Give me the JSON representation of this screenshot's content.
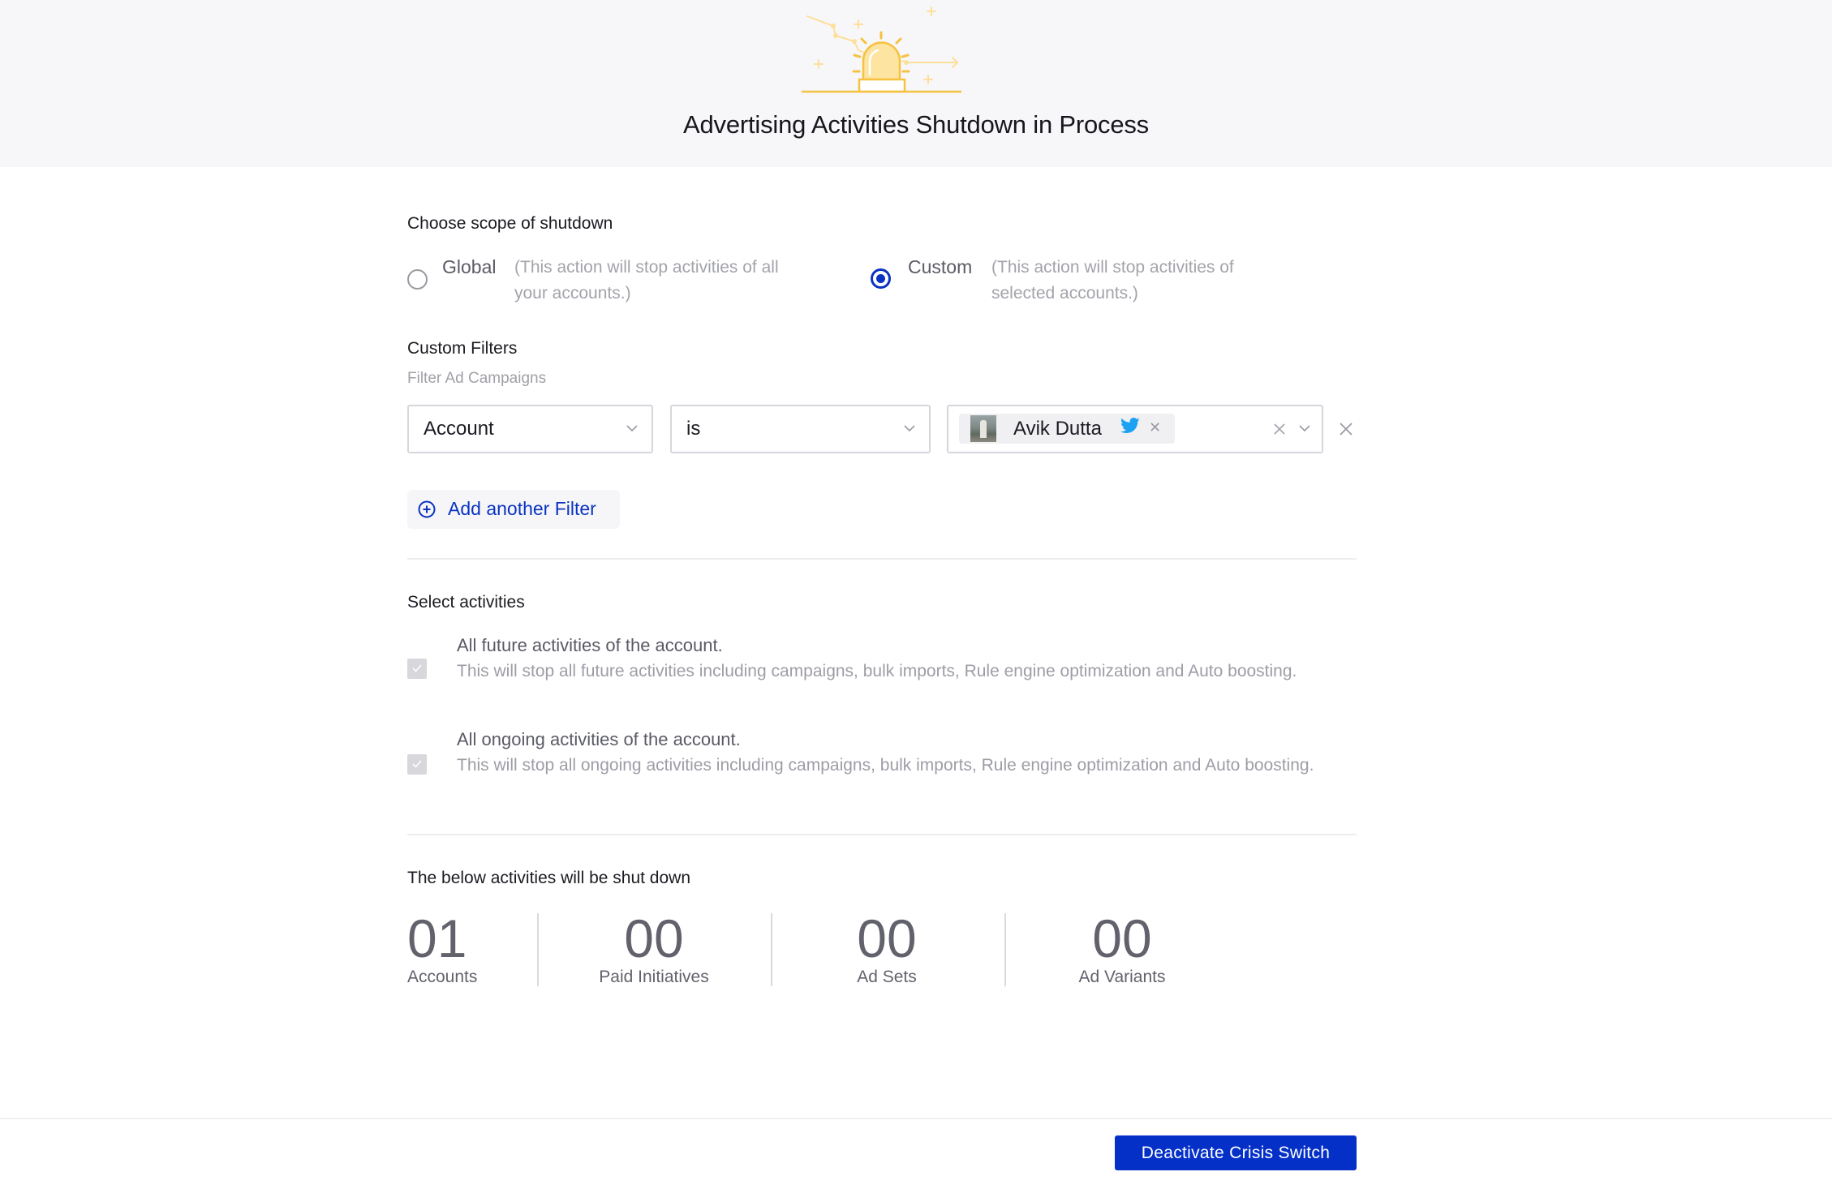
{
  "header": {
    "title": "Advertising Activities Shutdown in Process",
    "illustration": "siren-alert-icon"
  },
  "scope": {
    "label": "Choose scope of shutdown",
    "options": [
      {
        "label": "Global",
        "description": "(This action will stop activities of all your accounts.)",
        "desc_line1": "(This action will stop activities of all",
        "desc_line2": "your accounts.)",
        "selected": false
      },
      {
        "label": "Custom",
        "description": "(This action will stop activities of selected accounts.)",
        "desc_line1": "(This action will stop activities of",
        "desc_line2": "selected accounts.)",
        "selected": true
      }
    ]
  },
  "filters": {
    "label": "Custom Filters",
    "sublabel": "Filter Ad Campaigns",
    "rows": [
      {
        "field": "Account",
        "operator": "is",
        "values": [
          {
            "name": "Avik Dutta",
            "network": "twitter-icon"
          }
        ]
      }
    ],
    "add_label": "Add another Filter"
  },
  "activities": {
    "label": "Select activities",
    "items": [
      {
        "title": "All future activities of the account.",
        "description": "This will stop all future activities including campaigns, bulk imports, Rule engine optimization and Auto boosting.",
        "checked": true,
        "disabled": true
      },
      {
        "title": "All ongoing activities of the account.",
        "description": "This will stop all ongoing activities including campaigns, bulk imports, Rule engine optimization and Auto boosting.",
        "checked": true,
        "disabled": true
      }
    ]
  },
  "summary": {
    "label": "The below activities will be shut down",
    "stats": [
      {
        "value": "01",
        "label": "Accounts"
      },
      {
        "value": "00",
        "label": "Paid Initiatives"
      },
      {
        "value": "00",
        "label": "Ad Sets"
      },
      {
        "value": "00",
        "label": "Ad Variants"
      }
    ]
  },
  "footer": {
    "primary_label": "Deactivate Crisis Switch"
  },
  "colors": {
    "accent": "#0a33c2",
    "primary_button": "#0430c8",
    "header_bg": "#f7f7f9",
    "siren": "#f5c242",
    "twitter": "#1da1f2"
  }
}
